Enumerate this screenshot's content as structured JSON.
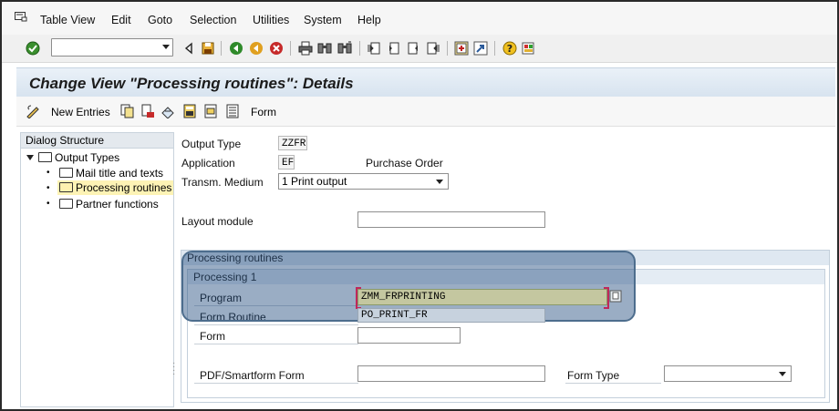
{
  "menubar": {
    "items": [
      "Table View",
      "Edit",
      "Goto",
      "Selection",
      "Utilities",
      "System",
      "Help"
    ]
  },
  "toolbar": {
    "command_field_value": "",
    "icons": [
      "enter-icon",
      "back-icon",
      "save-icon",
      "back-green-icon",
      "exit-icon",
      "cancel-icon",
      "print-icon",
      "find-icon",
      "find-next-icon",
      "first-page-icon",
      "prev-page-icon",
      "next-page-icon",
      "last-page-icon",
      "create-session-icon",
      "shortcut-icon",
      "help-icon",
      "customize-layout-icon"
    ]
  },
  "title": "Change View \"Processing routines\": Details",
  "app_toolbar": {
    "new_entries": "New Entries",
    "form": "Form"
  },
  "dialog_structure": {
    "header": "Dialog Structure",
    "root": "Output Types",
    "children": [
      "Mail title and texts",
      "Processing routines",
      "Partner functions"
    ],
    "selected": "Processing routines"
  },
  "fields": {
    "output_type_label": "Output Type",
    "output_type_value": "ZZFR",
    "application_label": "Application",
    "application_value": "EF",
    "application_text": "Purchase Order",
    "transm_medium_label": "Transm. Medium",
    "transm_medium_value": "1 Print output",
    "layout_module_label": "Layout module",
    "layout_module_value": ""
  },
  "processing": {
    "outer_title": "Processing routines",
    "inner_title": "Processing 1",
    "program_label": "Program",
    "program_value": "ZMM_FRPRINTING",
    "form_routine_label": "Form Routine",
    "form_routine_value": "PO_PRINT_FR",
    "form_label": "Form",
    "form_value": "",
    "pdf_label": "PDF/Smartform Form",
    "pdf_value": "",
    "form_type_label": "Form Type",
    "form_type_value": ""
  },
  "colors": {
    "highlight": "#1f497d",
    "title_bar": "#dce7f1",
    "program_field": "#c4c7a0"
  }
}
